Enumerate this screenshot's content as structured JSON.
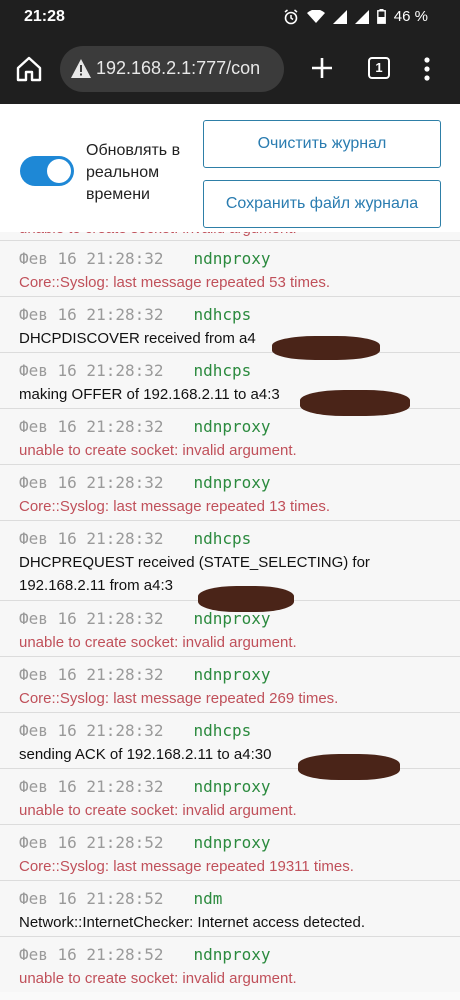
{
  "status": {
    "time": "21:28",
    "battery": "46 %"
  },
  "browser": {
    "url": "192.168.2.1:777/con",
    "tab_count": "1"
  },
  "controls": {
    "toggle_label": "Обновлять в реальном времени",
    "toggle_on": true,
    "clear_label": "Очистить журнал",
    "save_label": "Сохранить файл журнала"
  },
  "log": {
    "partial_msg": "unable to create socket: invalid argument.",
    "entries": [
      {
        "date": "Фев 16 21:28:32",
        "source": "ndnproxy",
        "message": "Core::Syslog: last message repeated 53 times."
      },
      {
        "date": "Фев 16 21:28:32",
        "source": "ndhcps",
        "message": "DHCPDISCOVER received from a4"
      },
      {
        "date": "Фев 16 21:28:32",
        "source": "ndhcps",
        "message": "making OFFER of 192.168.2.11 to a4:3"
      },
      {
        "date": "Фев 16 21:28:32",
        "source": "ndnproxy",
        "message": "unable to create socket: invalid argument."
      },
      {
        "date": "Фев 16 21:28:32",
        "source": "ndnproxy",
        "message": "Core::Syslog: last message repeated 13 times."
      },
      {
        "date": "Фев 16 21:28:32",
        "source": "ndhcps",
        "message": "DHCPREQUEST received (STATE_SELECTING) for",
        "message2": "192.168.2.11 from a4:3"
      },
      {
        "date": "Фев 16 21:28:32",
        "source": "ndnproxy",
        "message": "unable to create socket: invalid argument."
      },
      {
        "date": "Фев 16 21:28:32",
        "source": "ndnproxy",
        "message": "Core::Syslog: last message repeated 269 times."
      },
      {
        "date": "Фев 16 21:28:32",
        "source": "ndhcps",
        "message": "sending ACK of 192.168.2.11 to a4:30"
      },
      {
        "date": "Фев 16 21:28:32",
        "source": "ndnproxy",
        "message": "unable to create socket: invalid argument."
      },
      {
        "date": "Фев 16 21:28:52",
        "source": "ndnproxy",
        "message": "Core::Syslog: last message repeated 19311 times."
      },
      {
        "date": "Фев 16 21:28:52",
        "source": "ndm",
        "message": "Network::InternetChecker: Internet access detected."
      },
      {
        "date": "Фев 16 21:28:52",
        "source": "ndnproxy",
        "message": "unable to create socket: invalid argument."
      }
    ]
  },
  "colors": {
    "accent": "#1e88d6",
    "error_text": "#c0505a",
    "source_text": "#2b8a3e",
    "date_text": "#9a9a9a"
  }
}
